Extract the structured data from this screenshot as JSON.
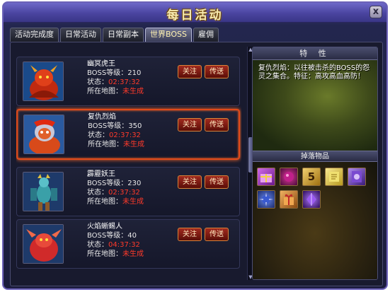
{
  "window": {
    "title": "每日活动",
    "close_label": "x"
  },
  "tabs": [
    {
      "label": "活动完成度"
    },
    {
      "label": "日常活动"
    },
    {
      "label": "日常副本"
    },
    {
      "label": "世界BOSS",
      "active": true
    },
    {
      "label": "雇佣"
    }
  ],
  "actions": {
    "follow": "关注",
    "teleport": "传送"
  },
  "bosses": [
    {
      "name": "幽冥虎王",
      "level_label": "BOSS等级：",
      "level": "210",
      "status_label": "状态：",
      "status": "02:37:32",
      "map_label": "所在地图：",
      "map": "未生成",
      "portrait": "tiger-demon"
    },
    {
      "name": "复仇烈焰",
      "level_label": "BOSS等级：",
      "level": "350",
      "status_label": "状态：",
      "status": "02:37:32",
      "map_label": "所在地图：",
      "map": "未生成",
      "portrait": "flame-avenger",
      "selected": true
    },
    {
      "name": "霹靂妖王",
      "level_label": "BOSS等级：",
      "level": "230",
      "status_label": "状态：",
      "status": "02:37:32",
      "map_label": "所在地图：",
      "map": "未生成",
      "portrait": "thunder-demon"
    },
    {
      "name": "火焰蜥蜴人",
      "level_label": "BOSS等级：",
      "level": "40",
      "status_label": "状态：",
      "status": "04:37:32",
      "map_label": "所在地图：",
      "map": "未生成",
      "portrait": "fire-lizard"
    }
  ],
  "traits": {
    "header": "特 性",
    "description": "复仇烈焰：以往被击杀的BOSS的怨灵之集合。特征：高攻高血高防！"
  },
  "drops": {
    "header": "掉落物品",
    "items": [
      {
        "icon": "gift-box-icon",
        "color": "#b04ad0"
      },
      {
        "icon": "orb-icon",
        "color": "#a0207a"
      },
      {
        "icon": "number-card-icon",
        "label": "5",
        "color": "#d0a030"
      },
      {
        "icon": "scroll-icon",
        "color": "#d8c040"
      },
      {
        "icon": "rune-card-icon",
        "color": "#8a4ad0"
      },
      {
        "icon": "spiked-orb-icon",
        "color": "#4a6ad0"
      },
      {
        "icon": "gift-icon",
        "color": "#d08a30"
      },
      {
        "icon": "crystal-icon",
        "color": "#7a3ad8"
      }
    ]
  },
  "colors": {
    "accent": "#e24a1a",
    "timer": "#ff3a2a",
    "title": "#f5e9b0"
  }
}
